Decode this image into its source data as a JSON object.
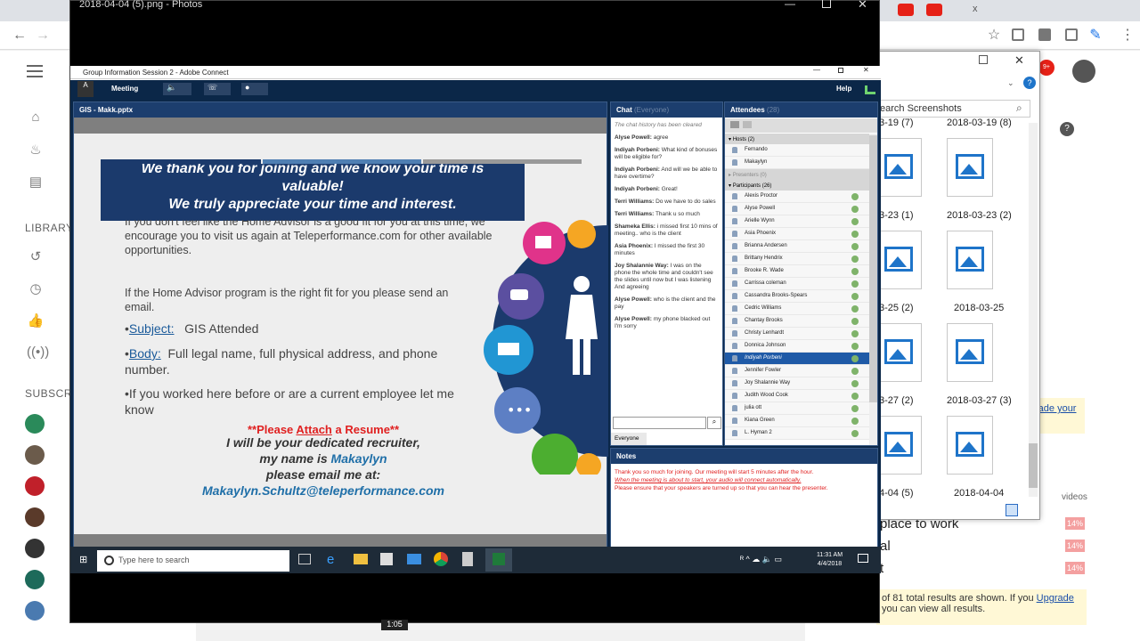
{
  "browser": {
    "tab_right": "x"
  },
  "youtube": {
    "library_label": "LIBRARY",
    "subscriptions_label": "SUBSCR",
    "right_top_label": "",
    "right_items": [
      "place to work",
      "al",
      "t"
    ],
    "right_badges": [
      "14%",
      "14%",
      "14%"
    ],
    "upgrade_text": "rade your",
    "results_text_1": "of 81 total results are shown. If you",
    "results_link": "Upgrade",
    "results_text_2": "you can view all results.",
    "videos_label": "videos"
  },
  "explorer": {
    "search_placeholder": "earch Screenshots",
    "top_labels": [
      "3-19 (7)",
      "2018-03-19 (8)"
    ],
    "captions": [
      "3-23 (1)",
      "2018-03-23 (2)",
      "3-25 (2)",
      "2018-03-25",
      "3-27 (2)",
      "2018-03-27 (3)",
      "4-04 (5)",
      "2018-04-04"
    ]
  },
  "photos": {
    "title": "2018-04-04 (5).png - Photos"
  },
  "connect": {
    "title": "Group Information Session 2 - Adobe Connect",
    "menu_meeting": "Meeting",
    "menu_help": "Help",
    "slide_pod_title": "GIS - Makk.pptx",
    "slide": {
      "banner_line1": "We thank you for joining and we know your time is",
      "banner_line2": "valuable!",
      "banner_line3": "We truly appreciate your time and interest.",
      "p1": "If you don't feel like the Home Advisor is a good fit for you at this time, we encourage you to visit us again at Teleperformance.com for other available opportunities.",
      "p2": "If the Home Advisor program is the right fit for you please send an email.",
      "subject_label": "Subject:",
      "subject_value": "GIS Attended",
      "body_label": "Body:",
      "body_value": "Full legal name, full physical address, and phone number.",
      "p3": "If you worked here before or are a current employee let me know",
      "attach_1": "**Please",
      "attach_2": "Attach",
      "attach_3": "a Resume**",
      "rec_1": "I will be your dedicated recruiter,",
      "rec_2": "my name is",
      "rec_name": "Makaylyn",
      "rec_3": "please email me at:",
      "rec_email": "Makaylyn.Schultz@teleperformance.com"
    },
    "chat": {
      "title": "Chat",
      "scope": "(Everyone)",
      "cleared": "The chat history has been cleared",
      "messages": [
        {
          "n": "Alyse Powell:",
          "t": "agree"
        },
        {
          "n": "Indiyah Porbeni:",
          "t": "What kind of bonuses will be eligible for?"
        },
        {
          "n": "Indiyah Porbeni:",
          "t": "And will we be able to have overtime?"
        },
        {
          "n": "Indiyah Porbeni:",
          "t": "Great!"
        },
        {
          "n": "Terri Williams:",
          "t": "Do we have to do sales"
        },
        {
          "n": "Terri Williams:",
          "t": "Thank u so much"
        },
        {
          "n": "Shameka Ellis:",
          "t": "i missed first 10 mins of meeting.. who is the client"
        },
        {
          "n": "Asia Phoenix:",
          "t": "I missed the first 30 minutes"
        },
        {
          "n": "Joy Shalannie Way:",
          "t": "I was on the phone the whole time and couldn't see the slides until now but I was listening And agreeing"
        },
        {
          "n": "Alyse Powell:",
          "t": "who is the client and the pay"
        },
        {
          "n": "Alyse Powell:",
          "t": "my phone blacked out I'm sorry"
        }
      ],
      "send_to": "Everyone"
    },
    "attendees": {
      "title": "Attendees",
      "count": "(28)",
      "hosts_label": "Hosts (2)",
      "hosts": [
        "Fernando",
        "Makaylyn"
      ],
      "presenters_label": "Presenters (0)",
      "participants_label": "Participants (26)",
      "participants": [
        "Alexis Proctor",
        "Alyse Powell",
        "Arielle Wynn",
        "Asia Phoenix",
        "Brianna Andersen",
        "Brittany Hendrix",
        "Brooke R. Wade",
        "Carrissa coleman",
        "Cassandra Brooks-Spears",
        "Cedric Williams",
        "Chantay Brooks",
        "Christy Lenhardt",
        "Donnica Johnson",
        "Indiyah Porbeni",
        "Jennifer Fowler",
        "Joy Shalannie Way",
        "Judith Wood Cook",
        "julia ott",
        "Kiana Green",
        "L. Hyman 2"
      ]
    },
    "notes": {
      "title": "Notes",
      "line1": "Thank you so much for joining. Our meeting will start 5 minutes after the hour.",
      "line2": "When the meeting is about to start, your audio will connect automatically.",
      "line3": "Please ensure that your speakers are turned up so that you can hear the presenter."
    }
  },
  "taskbar": {
    "search": "Type here to search",
    "time": "11:31 AM",
    "date": "4/4/2018"
  },
  "video": {
    "timestamp": "1:05"
  }
}
